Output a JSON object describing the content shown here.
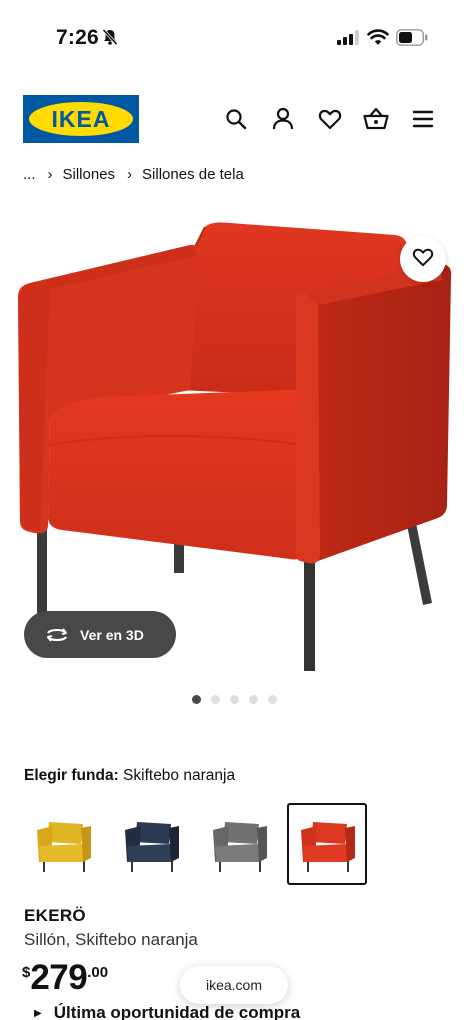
{
  "status_bar": {
    "time": "7:26",
    "icons": [
      "bell-slash-icon",
      "signal-icon",
      "wifi-icon",
      "battery-icon"
    ]
  },
  "header": {
    "logo_text": "IKEA",
    "brand_colors": {
      "blue": "#0058a3",
      "yellow": "#ffdb00"
    },
    "icons": [
      "search-icon",
      "user-icon",
      "heart-icon",
      "basket-icon",
      "menu-icon"
    ]
  },
  "breadcrumb": {
    "ellipsis": "...",
    "items": [
      "Sillones",
      "Sillones de tela"
    ]
  },
  "gallery": {
    "view_3d_label": "Ver en 3D",
    "image_count": 5,
    "active_index": 0
  },
  "cover": {
    "label": "Elegir funda:",
    "selected": "Skiftebo naranja",
    "swatches": [
      {
        "name": "yellow",
        "color": "#e0b523"
      },
      {
        "name": "dark-blue",
        "color": "#253249"
      },
      {
        "name": "grey",
        "color": "#6b6b6b"
      },
      {
        "name": "orange-red",
        "color": "#d33a26",
        "selected": true
      }
    ]
  },
  "product": {
    "name": "EKERÖ",
    "description": "Sillón, Skiftebo naranja",
    "price_currency": "$",
    "price_integer": "279",
    "price_decimal": ".00",
    "last_chance": "Última oportunidad de compra"
  },
  "browser": {
    "url": "ikea.com"
  },
  "colors": {
    "chair_red": "#d8321f",
    "pill_dark": "#484848"
  }
}
